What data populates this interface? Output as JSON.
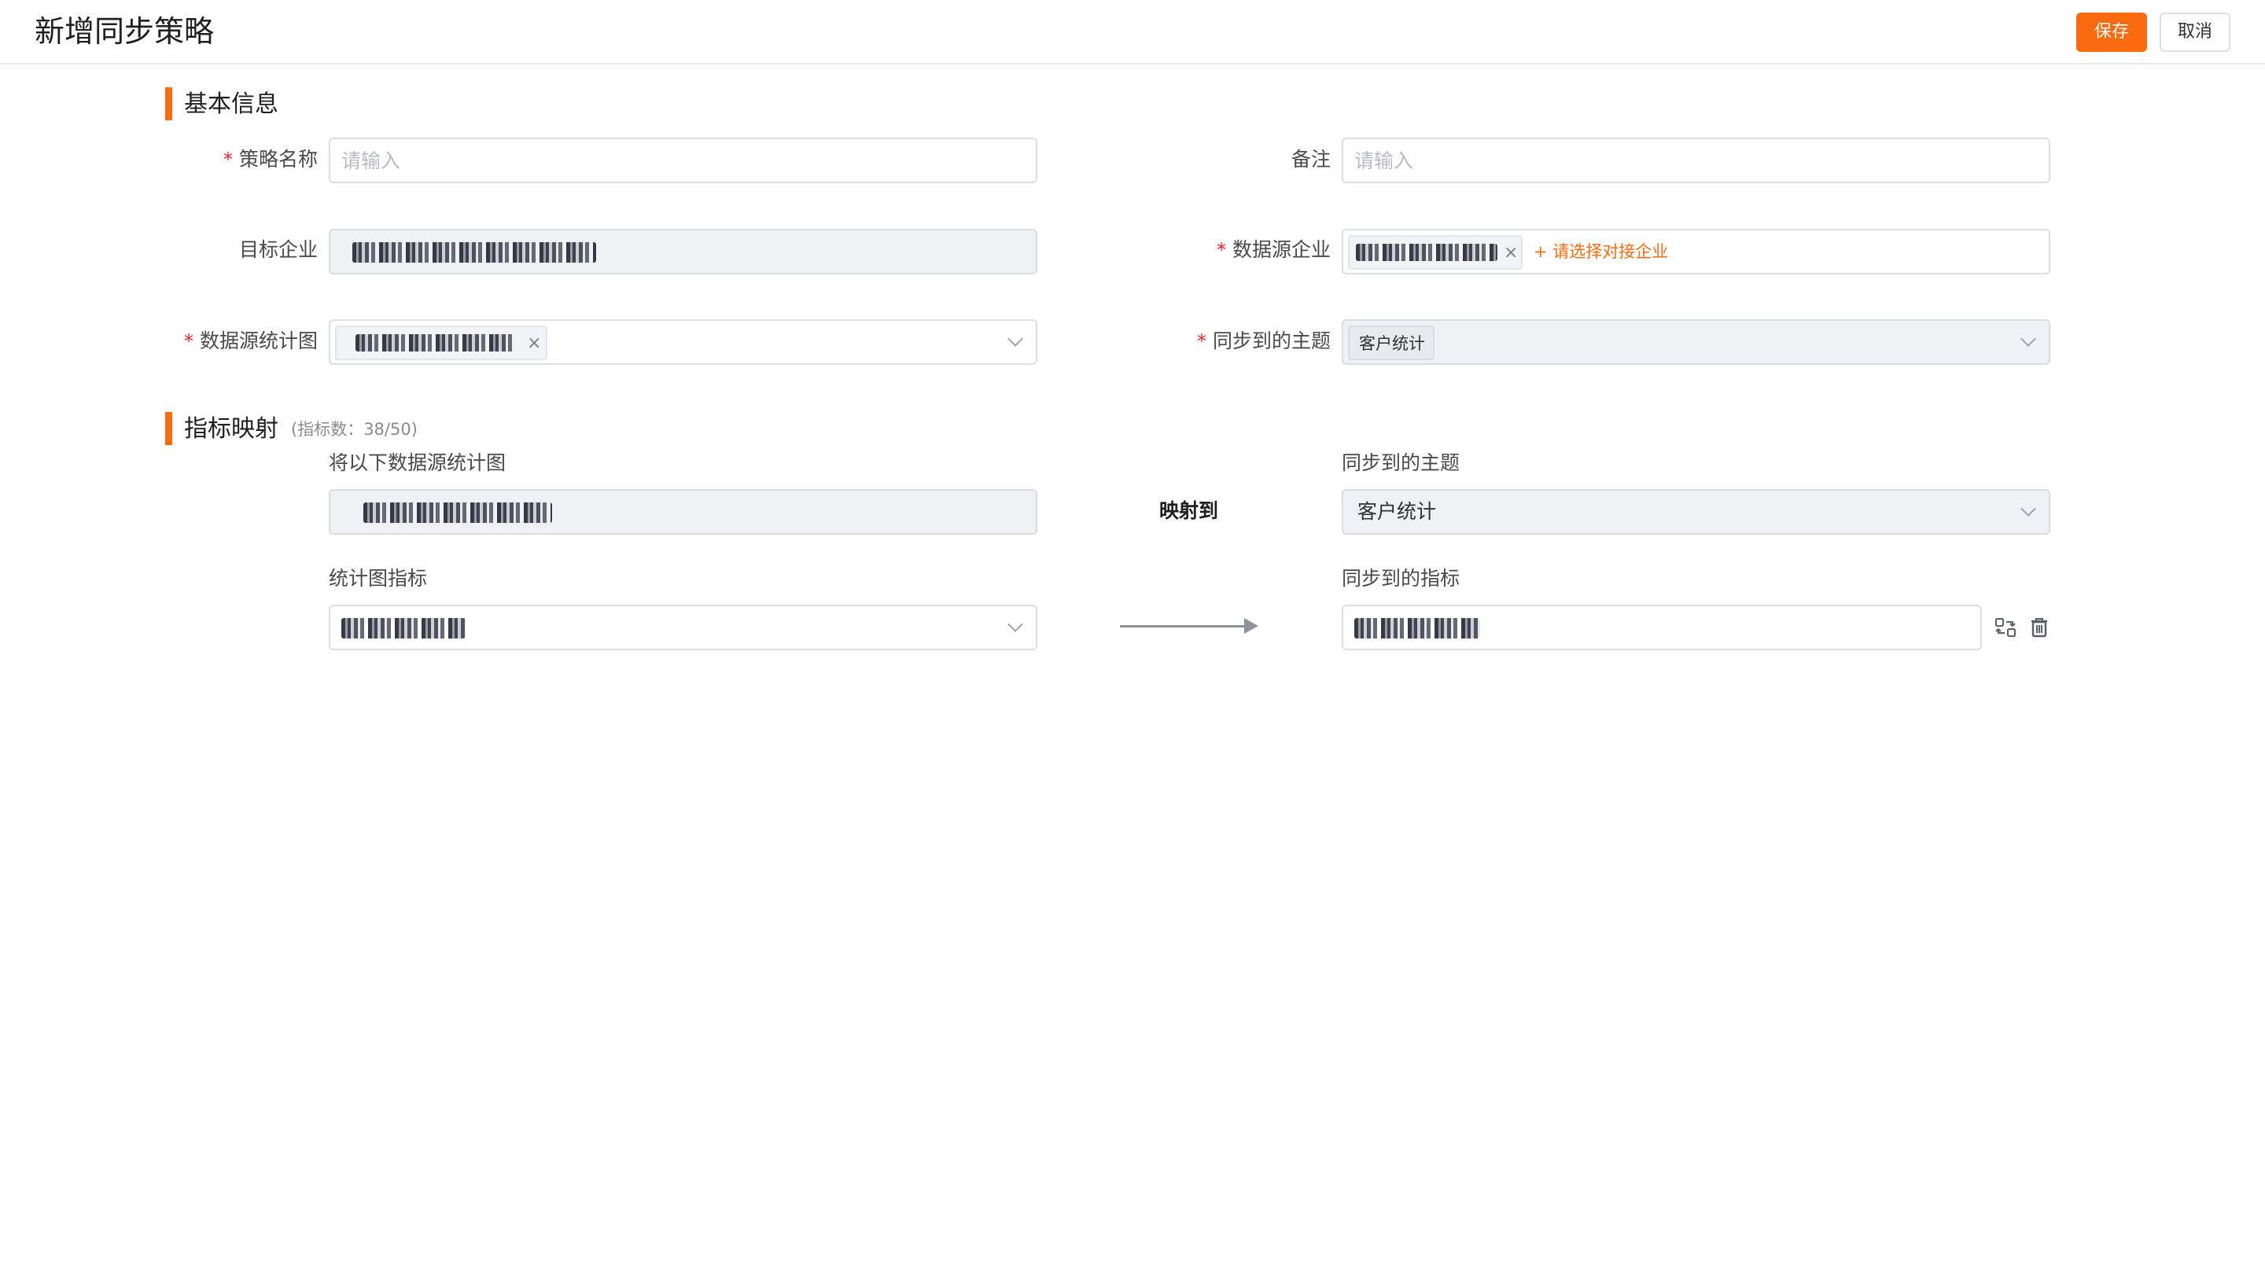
{
  "header": {
    "title": "新增同步策略",
    "save_label": "保存",
    "cancel_label": "取消"
  },
  "colors": {
    "accent": "#fa6a0f",
    "required": "#f5222d",
    "disabled_bg": "#f0f1f4"
  },
  "basic_info": {
    "title": "基本信息",
    "strategy_name": {
      "label": "策略名称",
      "required": true,
      "placeholder": "请输入",
      "value": ""
    },
    "remark": {
      "label": "备注",
      "required": false,
      "placeholder": "请输入",
      "value": ""
    },
    "target_enterprise": {
      "label": "目标企业",
      "required": false,
      "value_redacted": true
    },
    "source_enterprise": {
      "label": "数据源企业",
      "required": true,
      "tag_redacted": true,
      "add_link": "+ 请选择对接企业"
    },
    "source_chart": {
      "label": "数据源统计图",
      "required": true,
      "tag_redacted": true
    },
    "sync_topic": {
      "label": "同步到的主题",
      "required": true,
      "tag": "客户统计"
    }
  },
  "indicator_mapping": {
    "title": "指标映射",
    "count_text": "(指标数：38/50)",
    "source_chart_header": "将以下数据源统计图",
    "map_to_label": "映射到",
    "target_topic_header": "同步到的主题",
    "target_topic_value": "客户统计",
    "chart_indicator_header": "统计图指标",
    "target_indicator_header": "同步到的指标",
    "icons": [
      "swap-icon",
      "trash-icon",
      "chevron-down-icon",
      "close-icon",
      "arrow-right-icon"
    ]
  }
}
